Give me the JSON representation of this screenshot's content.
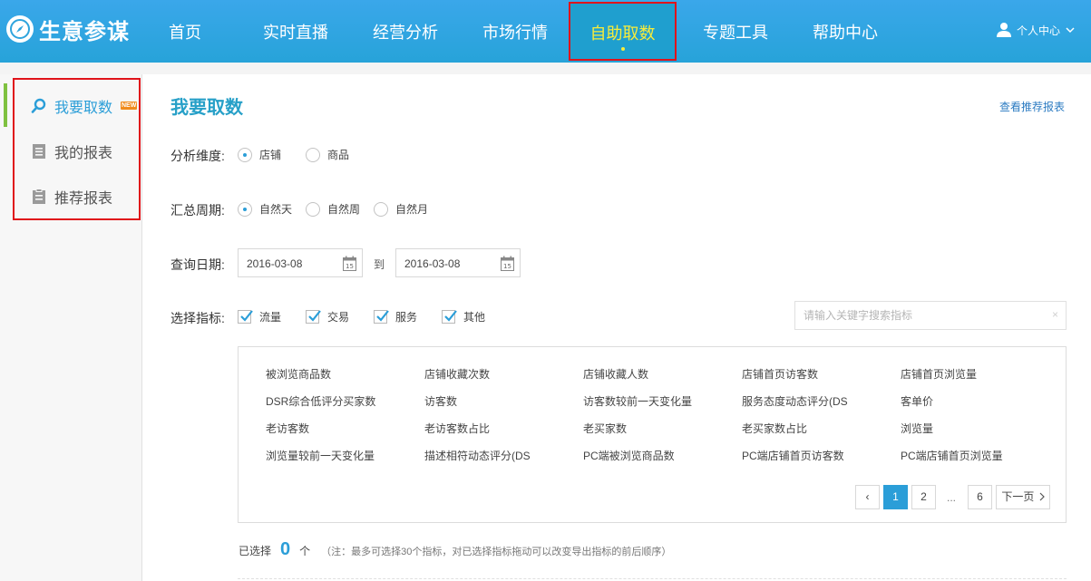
{
  "brand": {
    "name": "生意参谋"
  },
  "nav": {
    "items": [
      {
        "label": "首页"
      },
      {
        "label": "实时直播"
      },
      {
        "label": "经营分析"
      },
      {
        "label": "市场行情"
      },
      {
        "label": "自助取数",
        "active": true
      },
      {
        "label": "专题工具"
      },
      {
        "label": "帮助中心"
      }
    ],
    "user_label": "个人中心"
  },
  "sidebar": {
    "items": [
      {
        "label": "我要取数",
        "icon": "search-icon",
        "active": true,
        "badge": "NEW"
      },
      {
        "label": "我的报表",
        "icon": "document-icon"
      },
      {
        "label": "推荐报表",
        "icon": "clipboard-icon"
      }
    ]
  },
  "main": {
    "title": "我要取数",
    "recommend_link": "查看推荐报表",
    "dimension": {
      "label": "分析维度:",
      "options": [
        "店铺",
        "商品"
      ],
      "selected": "店铺"
    },
    "period": {
      "label": "汇总周期:",
      "options": [
        "自然天",
        "自然周",
        "自然月"
      ],
      "selected": "自然天"
    },
    "date": {
      "label": "查询日期:",
      "start": "2016-03-08",
      "to": "到",
      "end": "2016-03-08"
    },
    "indicators": {
      "label": "选择指标:",
      "categories": [
        "流量",
        "交易",
        "服务",
        "其他"
      ],
      "search_placeholder": "请输入关键字搜索指标",
      "clear": "×"
    },
    "metrics": [
      "被浏览商品数",
      "店铺收藏次数",
      "店铺收藏人数",
      "店铺首页访客数",
      "店铺首页浏览量",
      "DSR综合低评分买家数",
      "访客数",
      "访客数较前一天变化量",
      "服务态度动态评分(DS",
      "客单价",
      "老访客数",
      "老访客数占比",
      "老买家数",
      "老买家数占比",
      "浏览量",
      "浏览量较前一天变化量",
      "描述相符动态评分(DS",
      "PC端被浏览商品数",
      "PC端店铺首页访客数",
      "PC端店铺首页浏览量"
    ],
    "pagination": {
      "prev": "‹",
      "pages": [
        "1",
        "2",
        "6"
      ],
      "current": "1",
      "ellipsis": "...",
      "next": "下一页"
    },
    "selected": {
      "label": "已选择",
      "count": "0",
      "unit": "个",
      "note": "（注：最多可选择30个指标，对已选择指标拖动可以改变导出指标的前后顺序）"
    }
  },
  "colors": {
    "header": "#27a3d9",
    "accent": "#2b9ed8",
    "active_nav_text": "#f7ec3a",
    "highlight_border": "#e0131a",
    "title": "#27a0c8"
  }
}
